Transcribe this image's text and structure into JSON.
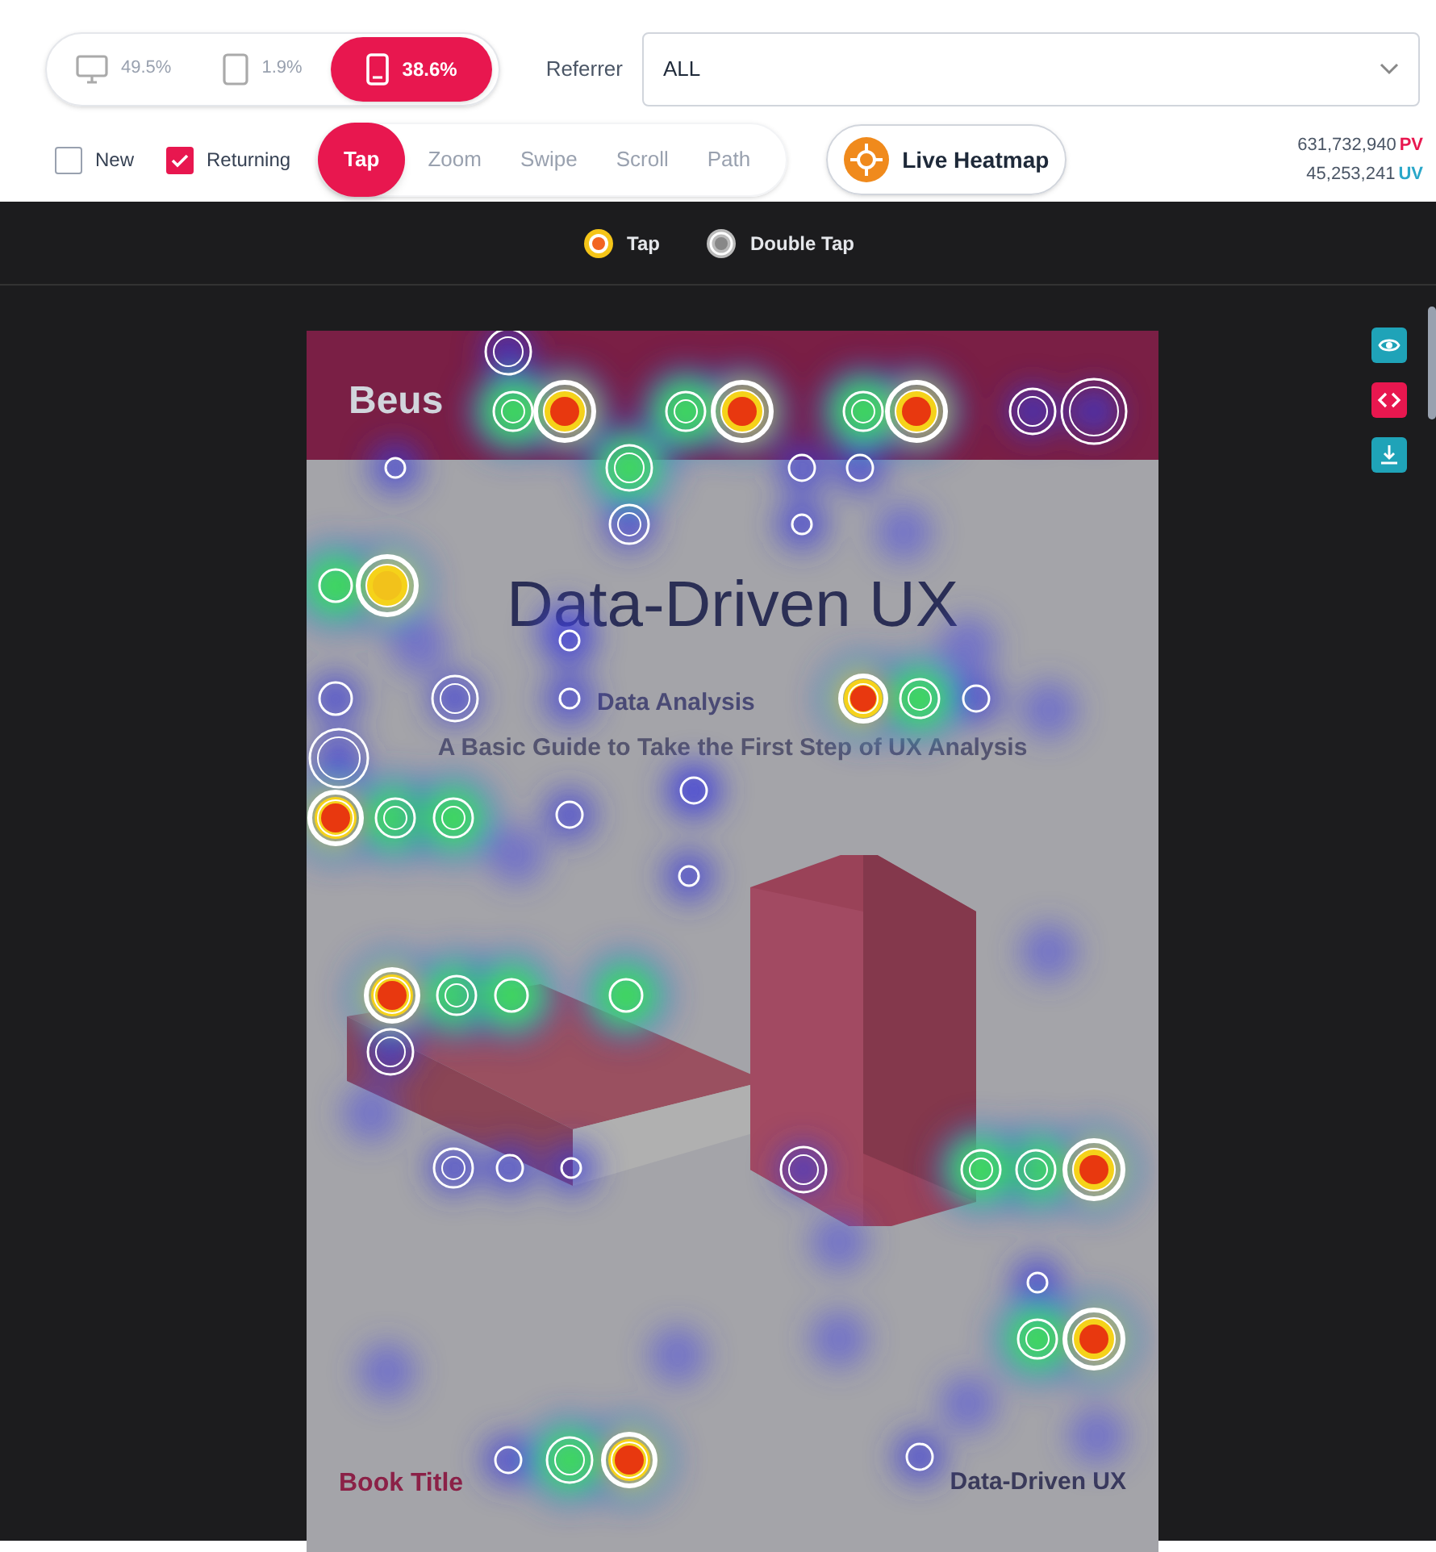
{
  "devices": [
    {
      "kind": "desktop",
      "share": "49.5%",
      "selected": false
    },
    {
      "kind": "tablet",
      "share": "1.9%",
      "selected": false
    },
    {
      "kind": "mobile",
      "share": "38.6%",
      "selected": true
    }
  ],
  "referrer": {
    "label": "Referrer",
    "value": "ALL"
  },
  "visitor_filters": [
    {
      "label": "New",
      "checked": false
    },
    {
      "label": "Returning",
      "checked": true
    }
  ],
  "gestures": [
    {
      "label": "Tap",
      "selected": true
    },
    {
      "label": "Zoom",
      "selected": false
    },
    {
      "label": "Swipe",
      "selected": false
    },
    {
      "label": "Scroll",
      "selected": false
    },
    {
      "label": "Path",
      "selected": false
    }
  ],
  "live_button": {
    "label": "Live Heatmap"
  },
  "stats": [
    {
      "value": "631,732,940",
      "unit": "PV",
      "color": "#e8174f"
    },
    {
      "value": "45,253,241",
      "unit": "UV",
      "color": "#2aa7c9"
    }
  ],
  "legend": [
    {
      "kind": "tap",
      "label": "Tap"
    },
    {
      "kind": "double_tap",
      "label": "Double Tap"
    }
  ],
  "page_preview": {
    "brand": "Beus",
    "title": "Data-Driven UX",
    "subtitle": "Data Analysis",
    "tagline": "A Basic Guide to Take the First Step of UX Analysis",
    "footer_left": "Book Title",
    "footer_right": "Data-Driven UX"
  },
  "side_tools": [
    {
      "kind": "eye"
    },
    {
      "kind": "code"
    },
    {
      "kind": "download"
    }
  ]
}
